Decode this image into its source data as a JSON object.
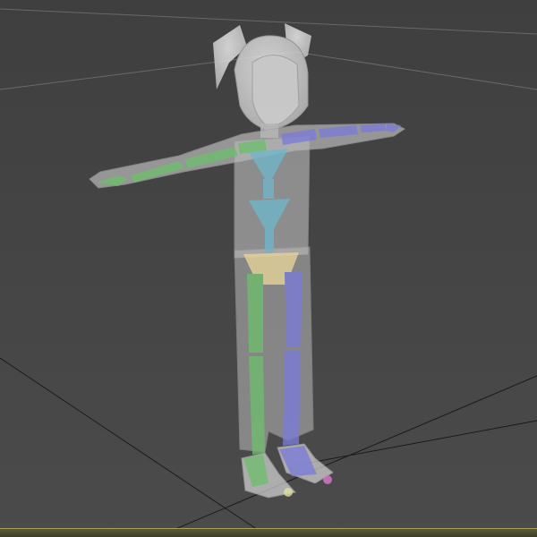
{
  "viewport": {
    "view_name": "",
    "background": "#454545",
    "grid_color": "#1a1a1a",
    "frame_color": "#a89e55"
  },
  "model": {
    "skin_color": "#d9d9d9",
    "mesh_opacity": 0.62,
    "bones": {
      "left_side_color": "#6fbe6f",
      "right_side_color": "#7b7bd8",
      "spine_color": "#6fb7c9",
      "pelvis_color": "#e8d59a",
      "foot_tip_colors": [
        "#e0e0a0",
        "#e07ad0"
      ]
    }
  }
}
